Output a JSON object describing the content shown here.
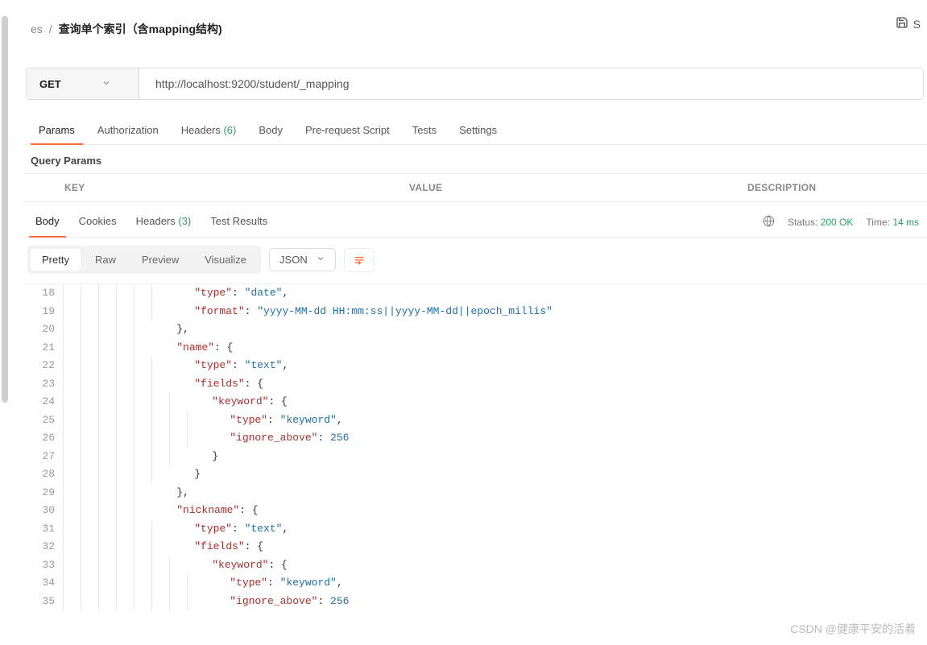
{
  "breadcrumb": {
    "crumb1": "es",
    "sep": "/",
    "crumb2": "查询单个索引（含mapping结构)"
  },
  "topActions": {
    "saveLabel": "S"
  },
  "request": {
    "method": "GET",
    "url": "http://localhost:9200/student/_mapping"
  },
  "tabs": {
    "params": "Params",
    "authorization": "Authorization",
    "headers": "Headers",
    "headersCount": "(6)",
    "body": "Body",
    "prerequest": "Pre-request Script",
    "tests": "Tests",
    "settings": "Settings"
  },
  "sectionHeader": "Query Params",
  "paramsTable": {
    "key": "KEY",
    "value": "VALUE",
    "description": "DESCRIPTION"
  },
  "responseTabs": {
    "body": "Body",
    "cookies": "Cookies",
    "headers": "Headers",
    "headersCount": "(3)",
    "testResults": "Test Results"
  },
  "responseMeta": {
    "statusLabel": "Status:",
    "statusValue": "200 OK",
    "timeLabel": "Time:",
    "timeValue": "14 ms"
  },
  "viewTabs": {
    "pretty": "Pretty",
    "raw": "Raw",
    "preview": "Preview",
    "visualize": "Visualize"
  },
  "formatSelect": "JSON",
  "code": {
    "lines": [
      {
        "n": 18,
        "indent": 6,
        "tokens": [
          [
            "key",
            "\"type\""
          ],
          [
            "punc",
            ": "
          ],
          [
            "str",
            "\"date\""
          ],
          [
            "punc",
            ","
          ]
        ]
      },
      {
        "n": 19,
        "indent": 6,
        "tokens": [
          [
            "key",
            "\"format\""
          ],
          [
            "punc",
            ": "
          ],
          [
            "str",
            "\"yyyy-MM-dd HH:mm:ss||yyyy-MM-dd||epoch_millis\""
          ]
        ]
      },
      {
        "n": 20,
        "indent": 5,
        "tokens": [
          [
            "punc",
            "},"
          ]
        ]
      },
      {
        "n": 21,
        "indent": 5,
        "tokens": [
          [
            "key",
            "\"name\""
          ],
          [
            "punc",
            ": {"
          ]
        ]
      },
      {
        "n": 22,
        "indent": 6,
        "tokens": [
          [
            "key",
            "\"type\""
          ],
          [
            "punc",
            ": "
          ],
          [
            "str",
            "\"text\""
          ],
          [
            "punc",
            ","
          ]
        ]
      },
      {
        "n": 23,
        "indent": 6,
        "tokens": [
          [
            "key",
            "\"fields\""
          ],
          [
            "punc",
            ": {"
          ]
        ]
      },
      {
        "n": 24,
        "indent": 7,
        "tokens": [
          [
            "key",
            "\"keyword\""
          ],
          [
            "punc",
            ": {"
          ]
        ]
      },
      {
        "n": 25,
        "indent": 8,
        "tokens": [
          [
            "key",
            "\"type\""
          ],
          [
            "punc",
            ": "
          ],
          [
            "str",
            "\"keyword\""
          ],
          [
            "punc",
            ","
          ]
        ]
      },
      {
        "n": 26,
        "indent": 8,
        "tokens": [
          [
            "key",
            "\"ignore_above\""
          ],
          [
            "punc",
            ": "
          ],
          [
            "num",
            "256"
          ]
        ]
      },
      {
        "n": 27,
        "indent": 7,
        "tokens": [
          [
            "punc",
            "}"
          ]
        ]
      },
      {
        "n": 28,
        "indent": 6,
        "tokens": [
          [
            "punc",
            "}"
          ]
        ]
      },
      {
        "n": 29,
        "indent": 5,
        "tokens": [
          [
            "punc",
            "},"
          ]
        ]
      },
      {
        "n": 30,
        "indent": 5,
        "tokens": [
          [
            "key",
            "\"nickname\""
          ],
          [
            "punc",
            ": {"
          ]
        ]
      },
      {
        "n": 31,
        "indent": 6,
        "tokens": [
          [
            "key",
            "\"type\""
          ],
          [
            "punc",
            ": "
          ],
          [
            "str",
            "\"text\""
          ],
          [
            "punc",
            ","
          ]
        ]
      },
      {
        "n": 32,
        "indent": 6,
        "tokens": [
          [
            "key",
            "\"fields\""
          ],
          [
            "punc",
            ": {"
          ]
        ]
      },
      {
        "n": 33,
        "indent": 7,
        "tokens": [
          [
            "key",
            "\"keyword\""
          ],
          [
            "punc",
            ": {"
          ]
        ]
      },
      {
        "n": 34,
        "indent": 8,
        "tokens": [
          [
            "key",
            "\"type\""
          ],
          [
            "punc",
            ": "
          ],
          [
            "str",
            "\"keyword\""
          ],
          [
            "punc",
            ","
          ]
        ]
      },
      {
        "n": 35,
        "indent": 8,
        "tokens": [
          [
            "key",
            "\"ignore_above\""
          ],
          [
            "punc",
            ": "
          ],
          [
            "num",
            "256"
          ]
        ]
      }
    ]
  },
  "watermark": "CSDN @健康平安的活着"
}
